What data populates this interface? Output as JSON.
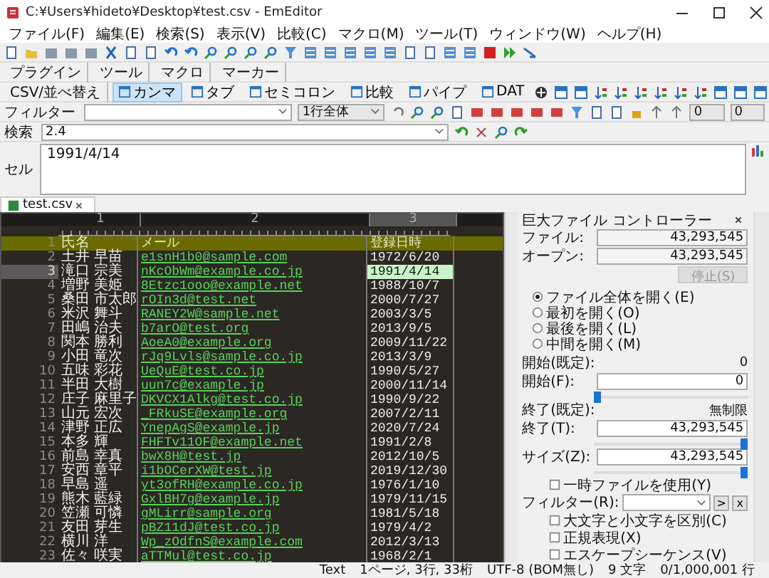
{
  "window": {
    "title": "C:¥Users¥hideto¥Desktop¥test.csv - EmEditor"
  },
  "menu": [
    "ファイル(F)",
    "編集(E)",
    "検索(S)",
    "表示(V)",
    "比較(C)",
    "マクロ(M)",
    "ツール(T)",
    "ウィンドウ(W)",
    "ヘルプ(H)"
  ],
  "toolbar_tabs": [
    "プラグイン",
    "ツール",
    "マクロ",
    "マーカー"
  ],
  "csv_bar": {
    "label": "CSV/並べ替え",
    "modes": [
      {
        "label": "カンマ",
        "selected": true
      },
      {
        "label": "タブ",
        "selected": false
      },
      {
        "label": "セミコロン",
        "selected": false
      },
      {
        "label": "比較",
        "selected": false
      },
      {
        "label": "パイプ",
        "selected": false
      },
      {
        "label": "DAT",
        "selected": false
      }
    ]
  },
  "filter_bar": {
    "label": "フィルター",
    "scope": "1行全体",
    "numbers": [
      "0",
      "0"
    ]
  },
  "search_bar": {
    "label": "検索",
    "value": "2.4"
  },
  "cell_editor": {
    "label": "セル",
    "value": "1991/4/14"
  },
  "document_tab": {
    "label": "test.csv"
  },
  "table": {
    "column_numbers": [
      "1",
      "2",
      "3"
    ],
    "header": {
      "line": "1",
      "cells": [
        "氏名",
        "メール",
        "登録日時"
      ]
    },
    "rows": [
      {
        "line": "2",
        "cells": [
          "土井 早苗",
          "e1snH1b0@sample.com",
          "1972/6/20"
        ],
        "selected": false
      },
      {
        "line": "3",
        "cells": [
          "滝口 宗美",
          "nKcObWm@example.co.jp",
          "1991/4/14"
        ],
        "selected": true
      },
      {
        "line": "4",
        "cells": [
          "増野 美姫",
          "8Etzc1ooo@example.net",
          "1988/10/7"
        ],
        "selected": false
      },
      {
        "line": "5",
        "cells": [
          "桑田 市太郎",
          "rOIn3d@test.net",
          "2000/7/27"
        ],
        "selected": false
      },
      {
        "line": "6",
        "cells": [
          "米沢 舞斗",
          "RANEY2W@sample.net",
          "2003/3/5"
        ],
        "selected": false
      },
      {
        "line": "7",
        "cells": [
          "田嶋 治夫",
          "b7arO@test.org",
          "2013/9/5"
        ],
        "selected": false
      },
      {
        "line": "8",
        "cells": [
          "関本 勝利",
          "AoeA0@example.org",
          "2009/11/22"
        ],
        "selected": false
      },
      {
        "line": "9",
        "cells": [
          "小田 竜次",
          "rJq9Lvls@sample.co.jp",
          "2013/3/9"
        ],
        "selected": false
      },
      {
        "line": "10",
        "cells": [
          "五味 彩花",
          "UeQuE@test.co.jp",
          "1990/5/27"
        ],
        "selected": false
      },
      {
        "line": "11",
        "cells": [
          "半田 大樹",
          "uun7c@example.jp",
          "2000/11/14"
        ],
        "selected": false
      },
      {
        "line": "12",
        "cells": [
          "庄子 麻里子",
          "DKVCX1Alkg@test.co.jp",
          "1990/9/22"
        ],
        "selected": false
      },
      {
        "line": "13",
        "cells": [
          "山元 宏次",
          "_FRkuSE@example.org",
          "2007/2/11"
        ],
        "selected": false
      },
      {
        "line": "14",
        "cells": [
          "津野 正広",
          "YnepAgS@example.jp",
          "2020/7/24"
        ],
        "selected": false
      },
      {
        "line": "15",
        "cells": [
          "本多 輝",
          "FHFTv11OF@example.net",
          "1991/2/8"
        ],
        "selected": false
      },
      {
        "line": "16",
        "cells": [
          "前島 幸真",
          "bwX8H@test.jp",
          "2012/10/5"
        ],
        "selected": false
      },
      {
        "line": "17",
        "cells": [
          "安西 章平",
          "i1bOCerXW@test.jp",
          "2019/12/30"
        ],
        "selected": false
      },
      {
        "line": "18",
        "cells": [
          "早島 遥",
          "yt3ofRH@example.co.jp",
          "1976/1/10"
        ],
        "selected": false
      },
      {
        "line": "19",
        "cells": [
          "熊木 藍緑",
          "GxlBH7g@example.jp",
          "1979/11/15"
        ],
        "selected": false
      },
      {
        "line": "20",
        "cells": [
          "笠瀬 可憐",
          "gMLirr@sample.org",
          "1981/5/18"
        ],
        "selected": false
      },
      {
        "line": "21",
        "cells": [
          "友田 芽生",
          "pBZ11dJ@test.co.jp",
          "1979/4/2"
        ],
        "selected": false
      },
      {
        "line": "22",
        "cells": [
          "横川 洋",
          "Wp_zOdfnS@example.com",
          "2012/3/13"
        ],
        "selected": false
      },
      {
        "line": "23",
        "cells": [
          "佐々 咲実",
          "aTTMul@test.co.jp",
          "1968/2/1"
        ],
        "selected": false
      }
    ]
  },
  "controller": {
    "title": "巨大ファイル コントローラー",
    "file": {
      "label": "ファイル:",
      "value": "43,293,545"
    },
    "open": {
      "label": "オープン:",
      "value": "43,293,545"
    },
    "stop_button": {
      "label": "停止(S)",
      "disabled": true
    },
    "open_modes": [
      {
        "label": "ファイル全体を開く(E)",
        "selected": true
      },
      {
        "label": "最初を開く(O)",
        "selected": false
      },
      {
        "label": "最後を開く(L)",
        "selected": false
      },
      {
        "label": "中間を開く(M)",
        "selected": false
      }
    ],
    "start_default": {
      "label": "開始(既定):",
      "value": "0"
    },
    "start": {
      "label": "開始(F):",
      "value": "0",
      "level": 0
    },
    "end_default": {
      "label": "終了(既定):",
      "value": "無制限"
    },
    "end": {
      "label": "終了(T):",
      "value": "43,293,545",
      "level": 1
    },
    "size": {
      "label": "サイズ(Z):",
      "value": "43,293,545",
      "level": 1
    },
    "temp_file": {
      "label": "一時ファイルを使用(Y)",
      "checked": false
    },
    "filter": {
      "label": "フィルター(R):",
      "buttons": [
        ">",
        "x"
      ]
    },
    "options": [
      {
        "label": "大文字と小文字を区別(C)",
        "checked": false
      },
      {
        "label": "正規表現(X)",
        "checked": false
      },
      {
        "label": "エスケープシーケンス(V)",
        "checked": false
      }
    ]
  },
  "status_bar": [
    "Text",
    "1ページ, 3行, 33桁",
    "UTF-8 (BOM無し)",
    "9 文字",
    "0/1,000,001 行"
  ]
}
